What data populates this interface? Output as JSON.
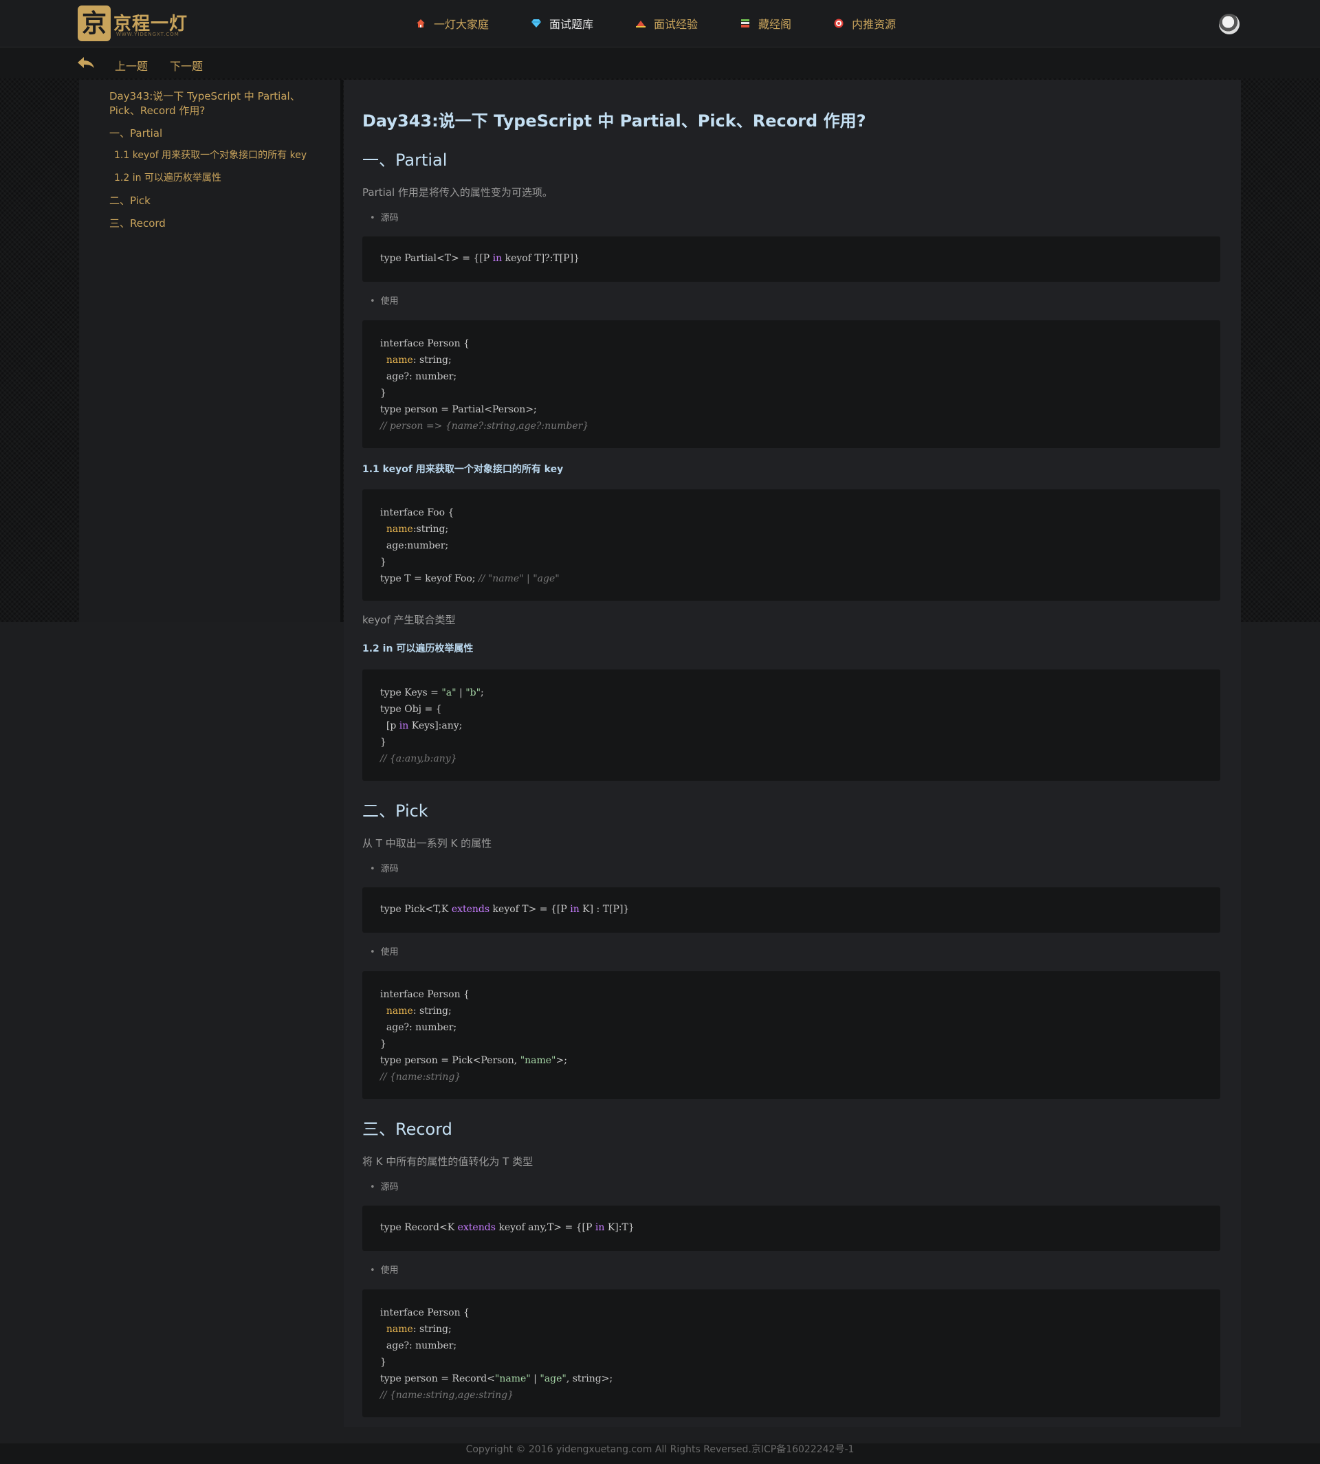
{
  "brand": {
    "logo_mark": "京",
    "logo_text": "京程一灯",
    "logo_sub": "WWW.YIDENGXT.COM"
  },
  "nav": {
    "items": [
      {
        "label": "一灯大家庭",
        "icon": "home-icon",
        "color": "#e85b3c"
      },
      {
        "label": "面试题库",
        "icon": "diamond-icon",
        "color": "#4fc3f7"
      },
      {
        "label": "面试经验",
        "icon": "hat-icon",
        "color": "#e0503a"
      },
      {
        "label": "藏经阁",
        "icon": "book-icon",
        "color": "#6fbf4f"
      },
      {
        "label": "内推资源",
        "icon": "target-icon",
        "color": "#e0413a"
      }
    ]
  },
  "subnav": {
    "prev": "上一题",
    "next": "下一题"
  },
  "toc": {
    "title": "Day343:说一下 TypeScript 中 Partial、Pick、Record 作用?",
    "items": [
      "一、Partial",
      "1.1 keyof 用来获取一个对象接口的所有 key",
      "1.2 in 可以遍历枚举属性",
      "二、Pick",
      "三、Record"
    ]
  },
  "article": {
    "title": "Day343:说一下 TypeScript 中 Partial、Pick、Record 作用?",
    "partial": {
      "heading": "一、Partial",
      "desc": "Partial 作用是将传入的属性变为可选项。",
      "source_label": "源码",
      "usage_label": "使用"
    },
    "keyof_heading": "1.1 keyof 用来获取一个对象接口的所有 key",
    "keyof_desc": "keyof 产生联合类型",
    "in_heading": "1.2 in 可以遍历枚举属性",
    "pick": {
      "heading": "二、Pick",
      "desc": "从 T 中取出一系列 K 的属性",
      "source_label": "源码",
      "usage_label": "使用"
    },
    "record": {
      "heading": "三、Record",
      "desc": "将 K 中所有的属性的值转化为 T 类型",
      "source_label": "源码",
      "usage_label": "使用"
    }
  },
  "footer": {
    "text": "Copyright © 2016 yidengxuetang.com All Rights Reversed.京ICP备16022242号-1"
  }
}
